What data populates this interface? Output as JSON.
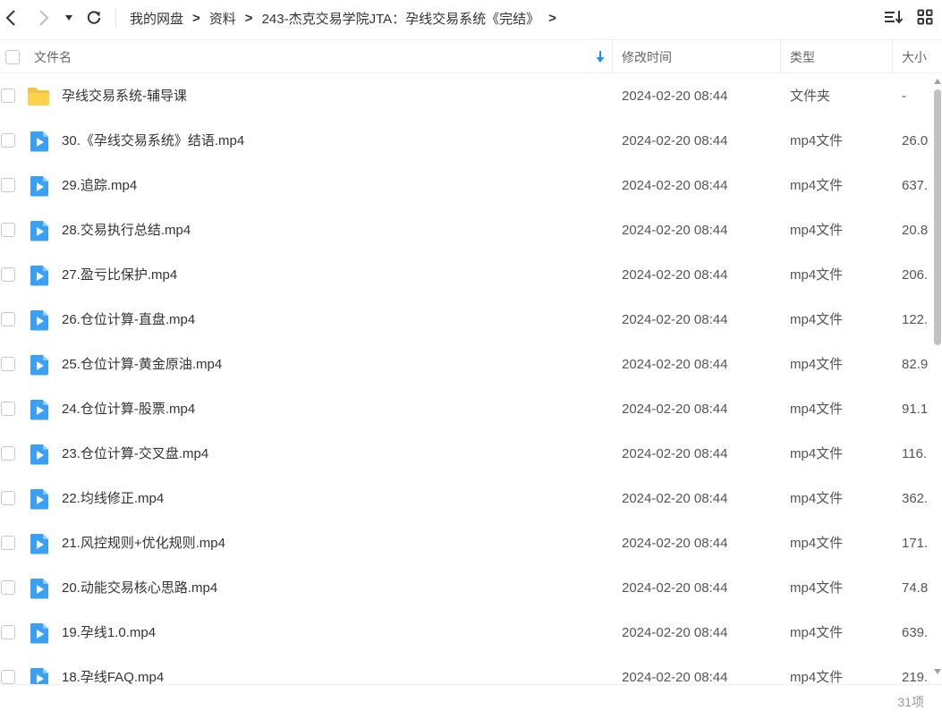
{
  "colors": {
    "folder": "#f9c23c",
    "video": "#3aa0f5",
    "accent": "#1f8ff5"
  },
  "breadcrumb": {
    "items": [
      "我的网盘",
      "资料",
      "243-杰克交易学院JTA：孕线交易系统《完结》"
    ],
    "separator": ">"
  },
  "toolbar": {
    "sort_icon": "sort-list-icon",
    "view_icon": "grid-view-icon"
  },
  "columns": {
    "name": "文件名",
    "modified": "修改时间",
    "type": "类型",
    "size": "大小"
  },
  "files": [
    {
      "icon": "folder-icon",
      "name": "孕线交易系统-辅导课",
      "modified": "2024-02-20 08:44",
      "type": "文件夹",
      "size": "-"
    },
    {
      "icon": "video-file-icon",
      "name": "30.《孕线交易系统》结语.mp4",
      "modified": "2024-02-20 08:44",
      "type": "mp4文件",
      "size": "26.0"
    },
    {
      "icon": "video-file-icon",
      "name": "29.追踪.mp4",
      "modified": "2024-02-20 08:44",
      "type": "mp4文件",
      "size": "637."
    },
    {
      "icon": "video-file-icon",
      "name": "28.交易执行总结.mp4",
      "modified": "2024-02-20 08:44",
      "type": "mp4文件",
      "size": "20.8"
    },
    {
      "icon": "video-file-icon",
      "name": "27.盈亏比保护.mp4",
      "modified": "2024-02-20 08:44",
      "type": "mp4文件",
      "size": "206."
    },
    {
      "icon": "video-file-icon",
      "name": "26.仓位计算-直盘.mp4",
      "modified": "2024-02-20 08:44",
      "type": "mp4文件",
      "size": "122."
    },
    {
      "icon": "video-file-icon",
      "name": "25.仓位计算-黄金原油.mp4",
      "modified": "2024-02-20 08:44",
      "type": "mp4文件",
      "size": "82.9"
    },
    {
      "icon": "video-file-icon",
      "name": "24.仓位计算-股票.mp4",
      "modified": "2024-02-20 08:44",
      "type": "mp4文件",
      "size": "91.1"
    },
    {
      "icon": "video-file-icon",
      "name": "23.仓位计算-交叉盘.mp4",
      "modified": "2024-02-20 08:44",
      "type": "mp4文件",
      "size": "116."
    },
    {
      "icon": "video-file-icon",
      "name": "22.均线修正.mp4",
      "modified": "2024-02-20 08:44",
      "type": "mp4文件",
      "size": "362."
    },
    {
      "icon": "video-file-icon",
      "name": "21.风控规则+优化规则.mp4",
      "modified": "2024-02-20 08:44",
      "type": "mp4文件",
      "size": "171."
    },
    {
      "icon": "video-file-icon",
      "name": "20.动能交易核心思路.mp4",
      "modified": "2024-02-20 08:44",
      "type": "mp4文件",
      "size": "74.8"
    },
    {
      "icon": "video-file-icon",
      "name": "19.孕线1.0.mp4",
      "modified": "2024-02-20 08:44",
      "type": "mp4文件",
      "size": "639."
    },
    {
      "icon": "video-file-icon",
      "name": "18.孕线FAQ.mp4",
      "modified": "2024-02-20 08:44",
      "type": "mp4文件",
      "size": "219."
    }
  ],
  "footer": {
    "count": "31项"
  }
}
